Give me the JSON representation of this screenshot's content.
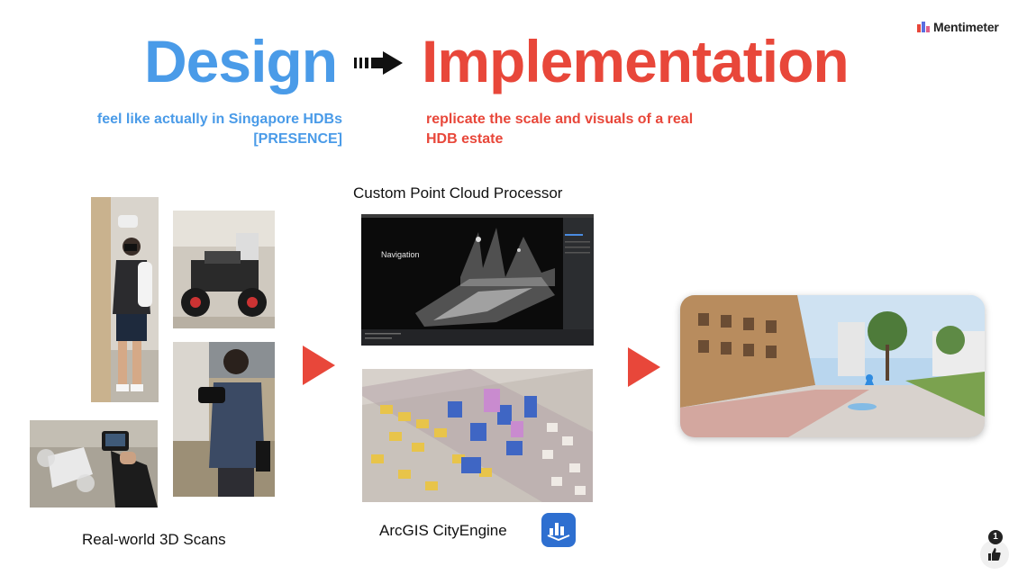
{
  "brand": {
    "name": "Mentimeter",
    "logo_icon": "mentimeter-logo-icon"
  },
  "title": {
    "left": "Design",
    "right": "Implementation",
    "arrow_icon": "dashed-arrow-right-icon"
  },
  "design_subtitle": {
    "line1": "feel like actually in Singapore HDBs",
    "line2": "[PRESENCE]"
  },
  "impl_subtitle": {
    "line1": "replicate the scale and visuals of a real",
    "line2": "HDB estate"
  },
  "captions": {
    "scans": "Real-world 3D Scans",
    "point_cloud": "Custom Point Cloud Processor",
    "cityengine": "ArcGIS CityEngine"
  },
  "point_cloud_window": {
    "overlay_label": "Navigation"
  },
  "reactions": {
    "like_count": "1",
    "like_icon": "thumbs-up-icon"
  },
  "colors": {
    "design_blue": "#4a9be8",
    "impl_red": "#e8473a"
  }
}
